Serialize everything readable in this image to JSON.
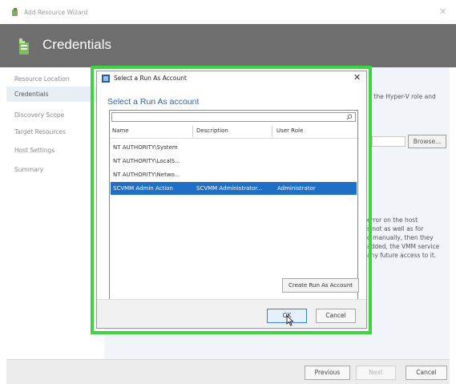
{
  "window": {
    "title": "Add Resource Wizard",
    "close_glyph": "✕"
  },
  "header": {
    "title": "Credentials",
    "icon": "credentials-wizard-icon"
  },
  "nav": {
    "items": [
      {
        "label": "Resource Location",
        "active": false
      },
      {
        "label": "Credentials",
        "active": true
      },
      {
        "label": "Discovery Scope",
        "active": false
      },
      {
        "label": "Target Resources",
        "active": false
      },
      {
        "label": "Host Settings",
        "active": false
      },
      {
        "label": "Summary",
        "active": false
      }
    ]
  },
  "background": {
    "hyperv_text": "ll the Hyper-V role and",
    "browse_label": "Browse...",
    "info_lines": [
      "error on the host",
      "s not as well as for",
      "d manually, then they",
      "added, the VMM service",
      "any future access to it."
    ]
  },
  "dialog": {
    "title": "Select a Run As Account",
    "close_glyph": "✕",
    "heading": "Select a Run As account",
    "search": {
      "value": "",
      "placeholder": ""
    },
    "columns": [
      "Name",
      "Description",
      "User Role"
    ],
    "rows": [
      {
        "name": "NT AUTHORITY\\System",
        "description": "",
        "user_role": "",
        "selected": false
      },
      {
        "name": "NT AUTHORITY\\LocalS...",
        "description": "",
        "user_role": "",
        "selected": false
      },
      {
        "name": "NT AUTHORITY\\Netwo...",
        "description": "",
        "user_role": "",
        "selected": false
      },
      {
        "name": "SCVMM Admin Action",
        "description": "SCVMM Administrator...",
        "user_role": "Administrator",
        "selected": true
      }
    ],
    "create_button": "Create Run As Account",
    "ok_button": "OK",
    "cancel_button": "Cancel"
  },
  "footer": {
    "previous": "Previous",
    "next": "Next",
    "cancel": "Cancel"
  },
  "colors": {
    "header_bg": "#6e6e6e",
    "highlight": "#3fd43f",
    "selection": "#1f6fc6",
    "heading": "#2f5e9e"
  }
}
